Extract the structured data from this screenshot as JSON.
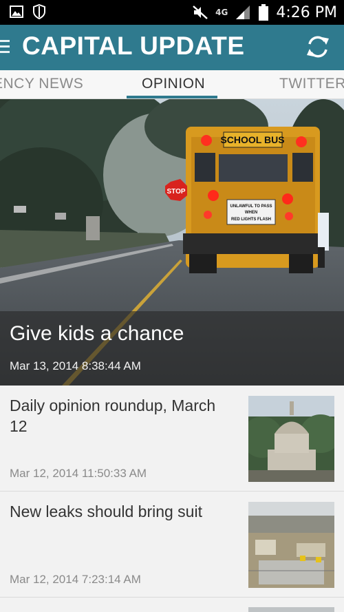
{
  "status_bar": {
    "network": "4G",
    "time": "4:26 PM"
  },
  "app_bar": {
    "title": "CAPITAL UPDATE"
  },
  "tabs": [
    {
      "label": "ENCY NEWS"
    },
    {
      "label": "OPINION"
    },
    {
      "label": "TWITTER"
    }
  ],
  "featured": {
    "title": "Give kids a chance",
    "date": "Mar 13, 2014  8:38:44 AM",
    "image": {
      "bus_sign": "SCHOOL BUS",
      "stop_sign": "STOP",
      "plate_line1": "UNLAWFUL TO PASS",
      "plate_line2": "WHEN",
      "plate_line3": "RED LIGHTS FLASH"
    }
  },
  "articles": [
    {
      "title": "Daily opinion roundup, March 12",
      "date": "Mar 12, 2014 11:50:33 AM"
    },
    {
      "title": "New leaks should bring suit",
      "date": "Mar 12, 2014  7:23:14 AM"
    }
  ],
  "colors": {
    "accent": "#2f7a8e",
    "status_bar": "#000000"
  }
}
